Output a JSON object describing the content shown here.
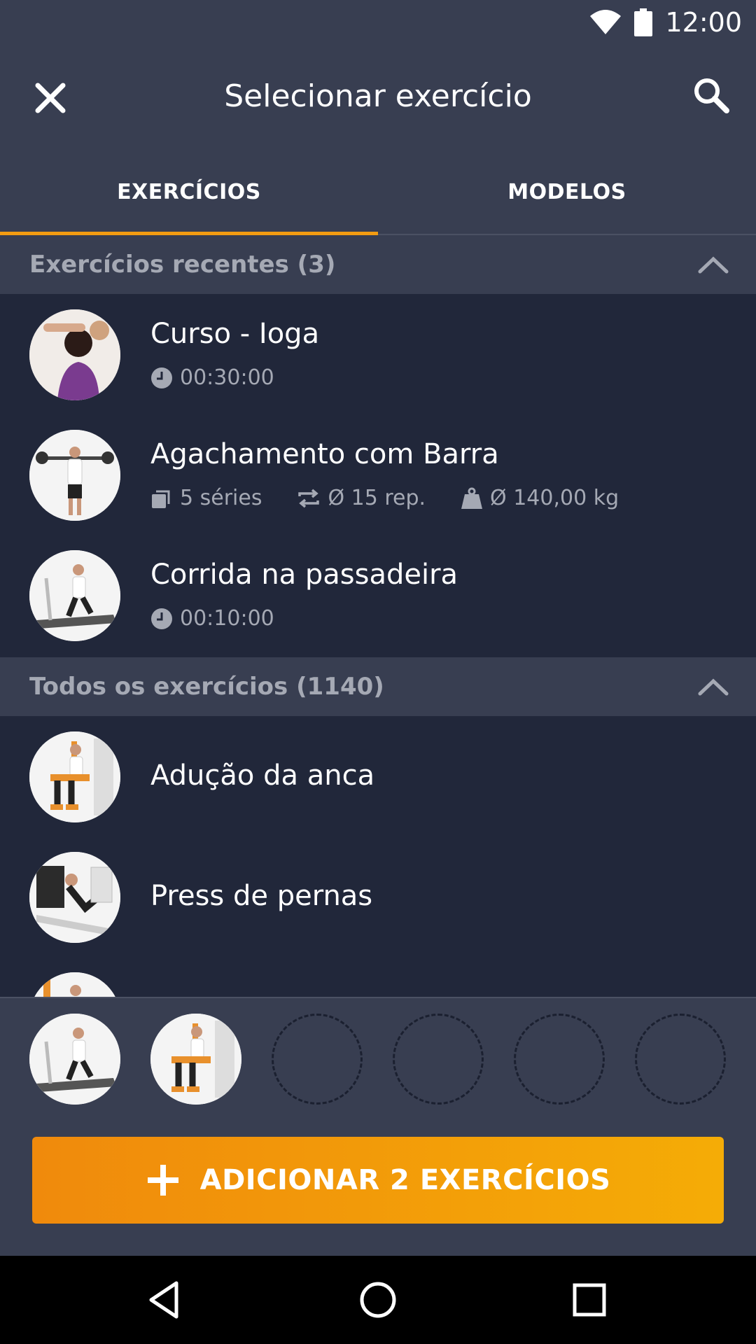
{
  "status_bar": {
    "time": "12:00"
  },
  "app_bar": {
    "title": "Selecionar exercício"
  },
  "tabs": [
    {
      "label": "EXERCÍCIOS",
      "active": true
    },
    {
      "label": "MODELOS",
      "active": false
    }
  ],
  "recent_section": {
    "title": "Exercícios recentes (3)",
    "items": [
      {
        "name": "Curso - Ioga",
        "duration": "00:30:00"
      },
      {
        "name": "Agachamento com Barra",
        "sets": "5 séries",
        "reps": "Ø 15 rep.",
        "weight": "Ø 140,00 kg"
      },
      {
        "name": "Corrida na passadeira",
        "duration": "00:10:00"
      }
    ]
  },
  "all_section": {
    "title": "Todos os exercícios (1140)",
    "items": [
      {
        "name": "Adução da anca"
      },
      {
        "name": "Press de pernas"
      }
    ]
  },
  "selection": {
    "selected_count": 2,
    "total_slots": 6
  },
  "add_button": {
    "label": "ADICIONAR 2 EXERCÍCIOS"
  },
  "colors": {
    "accent": "#f39c12",
    "background": "#21273a",
    "header": "#383e51",
    "muted_text": "#a5a9b4"
  }
}
